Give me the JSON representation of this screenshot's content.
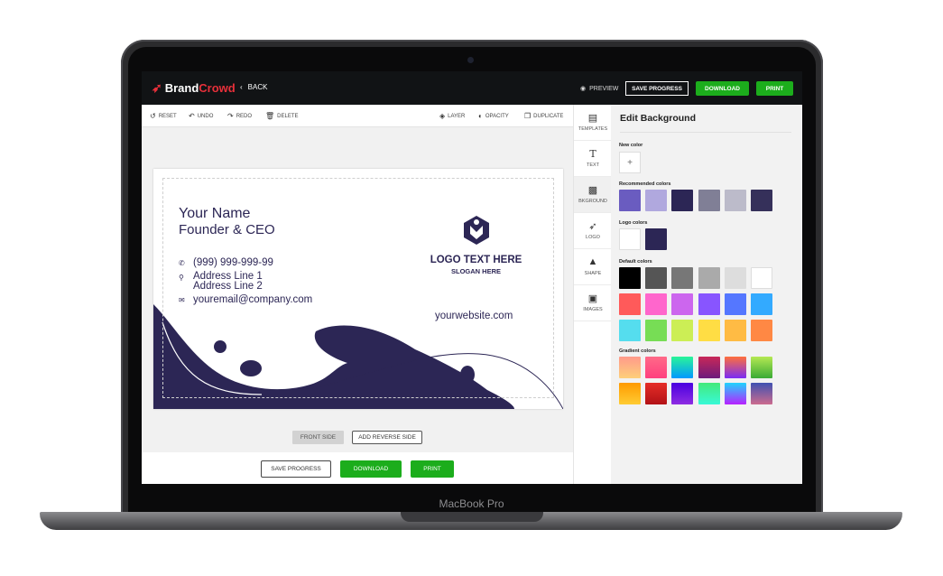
{
  "device": {
    "label": "MacBook Pro"
  },
  "topbar": {
    "logo_brand": "Brand",
    "logo_crowd": "Crowd",
    "back_label": "BACK",
    "preview_label": "PREVIEW",
    "save_progress_label": "SAVE PROGRESS",
    "download_label": "DOWNLOAD",
    "print_label": "PRINT"
  },
  "toolbar": {
    "reset": "RESET",
    "undo": "UNDO",
    "redo": "REDO",
    "delete": "DELETE",
    "layer": "LAYER",
    "opacity": "OPACITY",
    "duplicate": "DUPLICATE"
  },
  "card": {
    "name": "Your Name",
    "role": "Founder & CEO",
    "phone": "(999) 999-999-99",
    "address_line1": "Address Line 1",
    "address_line2": "Address Line 2",
    "email": "youremail@company.com",
    "logo_text": "LOGO TEXT HERE",
    "slogan": "SLOGAN HERE",
    "website": "yourwebsite.com",
    "accent_color": "#2c2655"
  },
  "sides": {
    "front_label": "FRONT SIDE",
    "reverse_label": "ADD REVERSE SIDE"
  },
  "bottom": {
    "save_progress_label": "SAVE PROGRESS",
    "download_label": "DOWNLOAD",
    "print_label": "PRINT"
  },
  "sidebar": {
    "tabs": [
      {
        "label": "TEMPLATES",
        "icon": "layout-icon"
      },
      {
        "label": "TEXT",
        "icon": "text-icon"
      },
      {
        "label": "BKGROUND",
        "icon": "background-icon"
      },
      {
        "label": "LOGO",
        "icon": "logo-icon"
      },
      {
        "label": "SHAPE",
        "icon": "shape-icon"
      },
      {
        "label": "IMAGES",
        "icon": "image-icon"
      }
    ],
    "active_index": 2
  },
  "panel": {
    "title": "Edit Background",
    "new_color_label": "New color",
    "recommended_label": "Recommended colors",
    "logo_label": "Logo colors",
    "default_label": "Default colors",
    "gradient_label": "Gradient colors",
    "recommended_colors": [
      "#6a5cc0",
      "#b0a8de",
      "#2c2655",
      "#807f96",
      "#bcbbca",
      "#35305a"
    ],
    "logo_colors": [
      "#ffffff",
      "#2c2655"
    ],
    "default_colors": [
      [
        "#000000",
        "#555555",
        "#777777",
        "#aaaaaa",
        "#dddddd",
        "#ffffff"
      ],
      [
        "#ff5a5a",
        "#ff66cc",
        "#cc66ee",
        "#8855ff",
        "#5577ff",
        "#33aaff"
      ],
      [
        "#55ddee",
        "#77dd55",
        "#ccee55",
        "#ffdd44",
        "#ffbb44",
        "#ff8844"
      ]
    ],
    "gradient_colors": [
      [
        [
          "#ff9a8b",
          "#fecf7a"
        ],
        [
          "#ff6a88",
          "#ff3f7f"
        ],
        [
          "#2af598",
          "#0098ff"
        ],
        [
          "#c82858",
          "#6d1b7b"
        ],
        [
          "#ff6f3c",
          "#7b2cf5"
        ],
        [
          "#b5e853",
          "#3aaa35"
        ]
      ],
      [
        [
          "#ff9a00",
          "#ffcc33"
        ],
        [
          "#e52d27",
          "#b31217"
        ],
        [
          "#4a00e0",
          "#8e2de2"
        ],
        [
          "#43e97b",
          "#38f9d7"
        ],
        [
          "#21d4fd",
          "#b721ff"
        ],
        [
          "#3f51b1",
          "#cc6b8e"
        ]
      ]
    ]
  }
}
